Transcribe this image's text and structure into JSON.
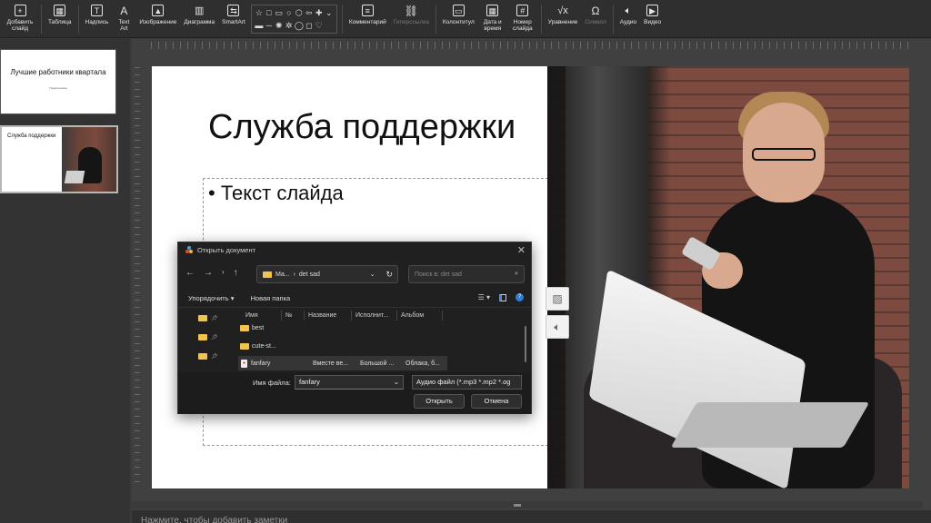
{
  "toolbar": {
    "add_slide": "Добавить слайд",
    "table": "Таблица",
    "textbox": "Надпись",
    "textart": "Text Art",
    "image": "Изображение",
    "chart": "Диаграмма",
    "smartart": "SmartArt",
    "comment": "Комментарий",
    "hyperlink": "Гиперссылка",
    "header_footer": "Колонтитул",
    "datetime": "Дата и время",
    "slide_number": "Номер слайда",
    "equation": "Уравнение",
    "symbol": "Символ",
    "audio": "Аудио",
    "video": "Видео"
  },
  "thumbnails": [
    {
      "title": "Лучшие работники квартала",
      "subtitle": "Подзаголовок"
    },
    {
      "title": "Служба поддержки"
    }
  ],
  "slide": {
    "title": "Служба поддержки",
    "bullet": "• Текст слайда"
  },
  "dialog": {
    "title": "Открыть документ",
    "path_prefix": "Ma...",
    "path_current": "det sad",
    "search_placeholder": "Поиск в: det sad",
    "organize": "Упорядочить",
    "new_folder": "Новая папка",
    "columns": [
      "Имя",
      "№",
      "Название",
      "Исполнит...",
      "Альбом"
    ],
    "files": [
      {
        "name": "best",
        "title": "",
        "artist": "",
        "album": ""
      },
      {
        "name": "cute-st...",
        "title": "",
        "artist": "",
        "album": ""
      },
      {
        "name": "fanfary",
        "title": "Вместе ве...",
        "artist": "Большой ...",
        "album": "Облака, б..."
      }
    ],
    "filename_label": "Имя файла:",
    "filename_value": "fanfary",
    "filetype_value": "Аудио файл (*.mp3 *.mp2 *.og",
    "open_button": "Открыть",
    "cancel_button": "Отмена"
  },
  "notes_placeholder": "Нажмите, чтобы добавить заметки"
}
